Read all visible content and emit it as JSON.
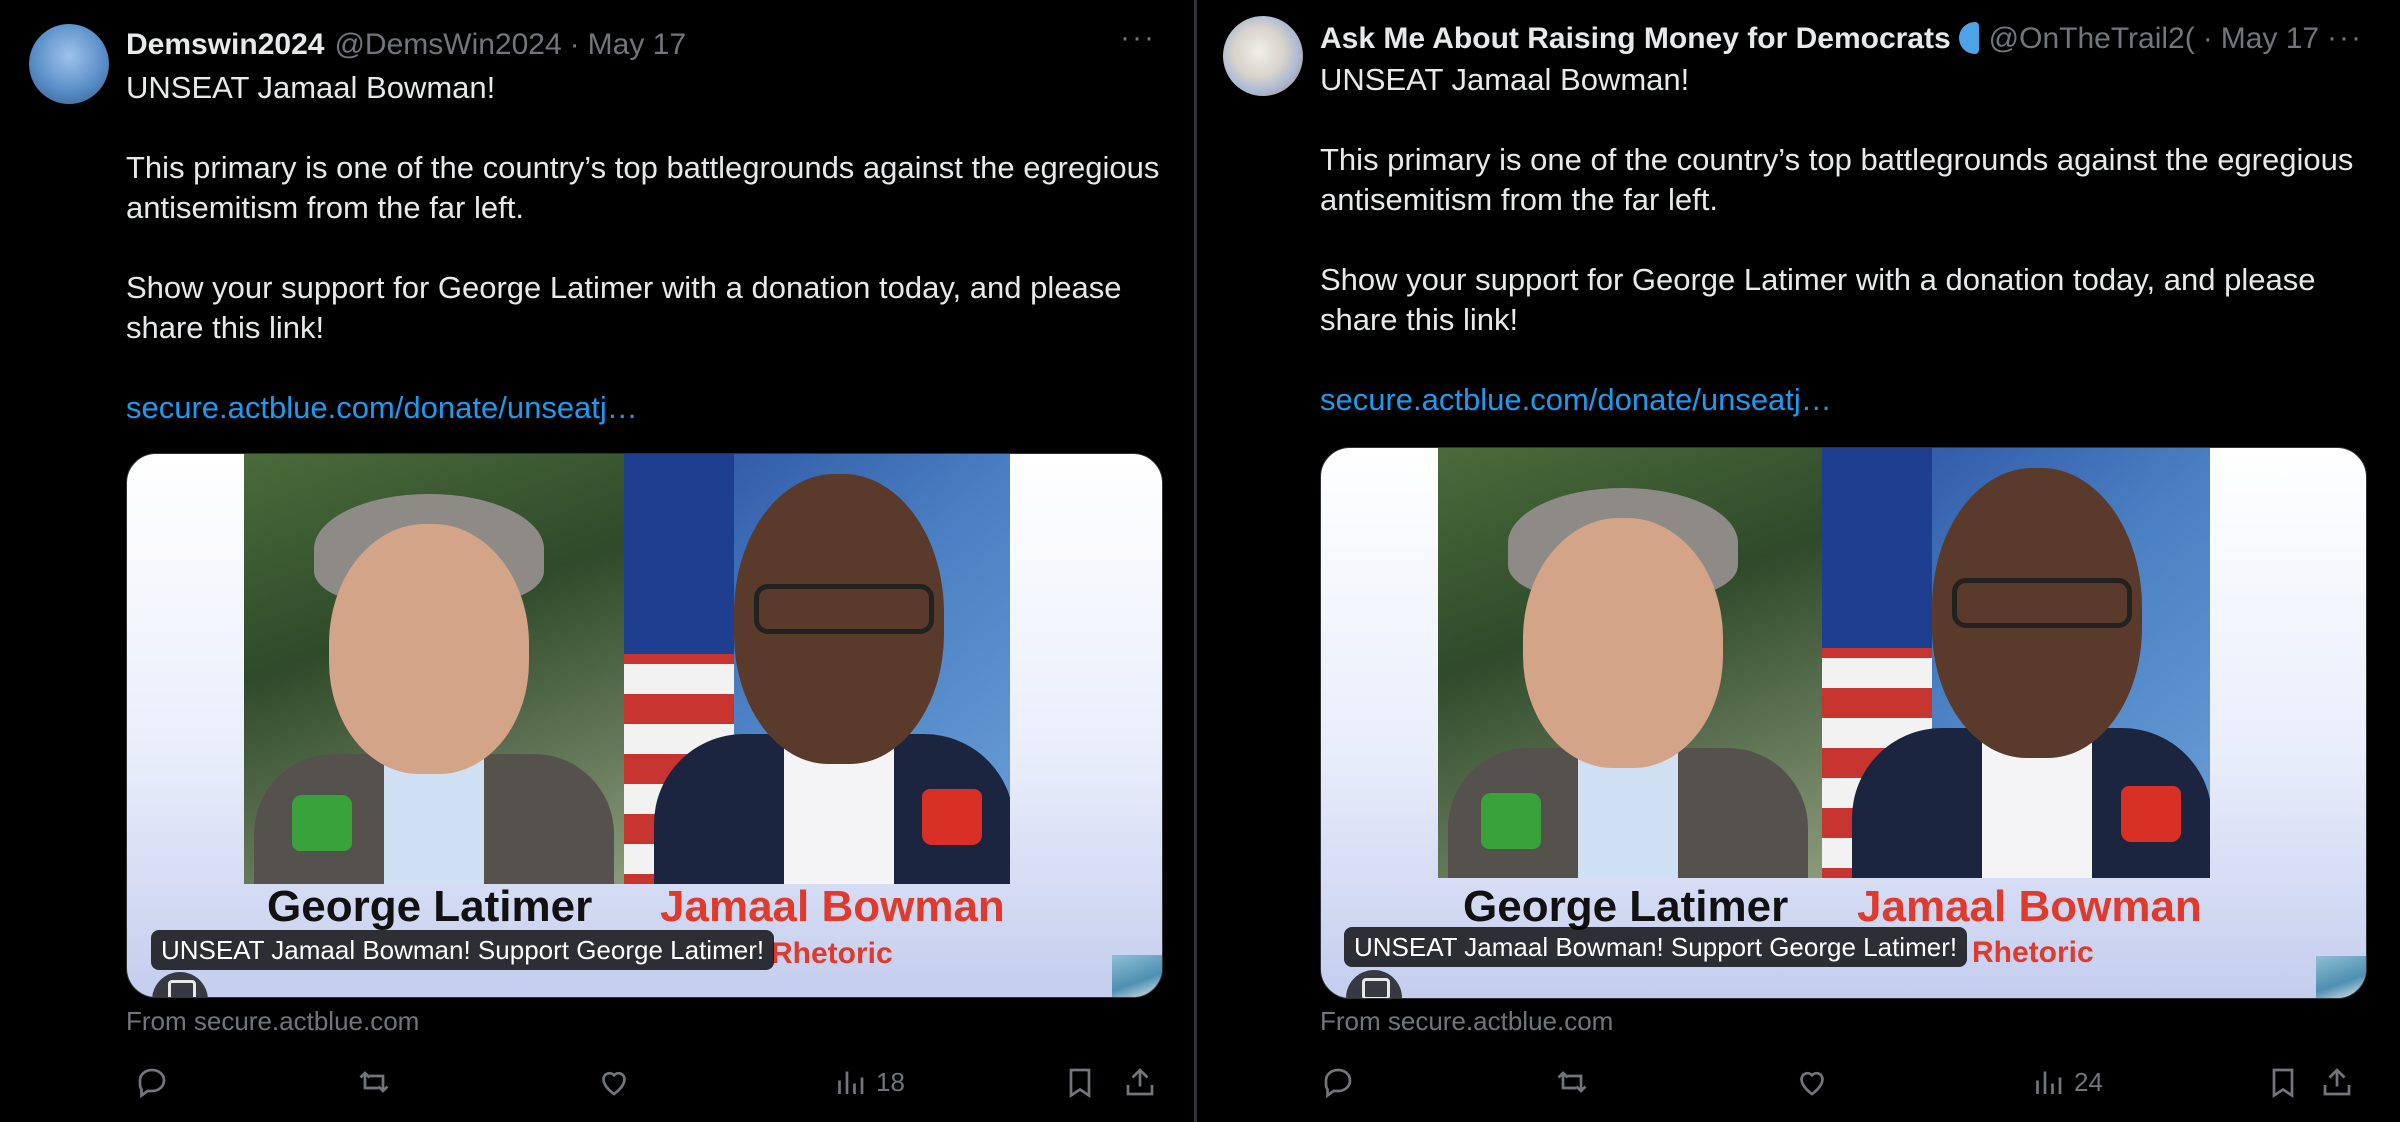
{
  "tweets": [
    {
      "author_name": "Demswin2024",
      "handle": "@DemsWin2024",
      "separator": "·",
      "date": "May 17",
      "more_label": "···",
      "text_line1": "UNSEAT Jamaal Bowman!",
      "text_para2": "This primary is one of the country’s top battlegrounds against the egregious antisemitism from the far left.",
      "text_para3": "Show your support for George Latimer with a donation today, and please share this link!",
      "link_text": "secure.actblue.com/donate/unseatj…",
      "card": {
        "name_left": "George Latimer",
        "name_right": "Jamaal Bowman",
        "subtext_right": "Rhetoric",
        "caption": "UNSEAT Jamaal Bowman! Support George Latimer!"
      },
      "from_text": "From secure.actblue.com",
      "views_count": "18"
    },
    {
      "author_name": "Ask Me About Raising Money for Democrats",
      "handle": "@OnTheTrail2(",
      "separator": "·",
      "date": "May 17",
      "more_label": "···",
      "text_line1": "UNSEAT Jamaal Bowman!",
      "text_para2": "This primary is one of the country’s top battlegrounds against the egregious antisemitism from the far left.",
      "text_para3": "Show your support for George Latimer with a donation today, and please share this link!",
      "link_text": "secure.actblue.com/donate/unseatj…",
      "card": {
        "name_left": "George Latimer",
        "name_right": "Jamaal Bowman",
        "subtext_right": "Rhetoric",
        "caption": "UNSEAT Jamaal Bowman! Support George Latimer!"
      },
      "from_text": "From secure.actblue.com",
      "views_count": "24"
    }
  ],
  "icons": [
    "reply-icon",
    "repost-icon",
    "like-icon",
    "views-icon",
    "bookmark-icon",
    "share-icon",
    "more-icon",
    "verified-badge-icon"
  ],
  "colors": {
    "background": "#000000",
    "text": "#e7e9ea",
    "muted": "#71767b",
    "link": "#1d9bf0",
    "divider": "#2f3336"
  }
}
